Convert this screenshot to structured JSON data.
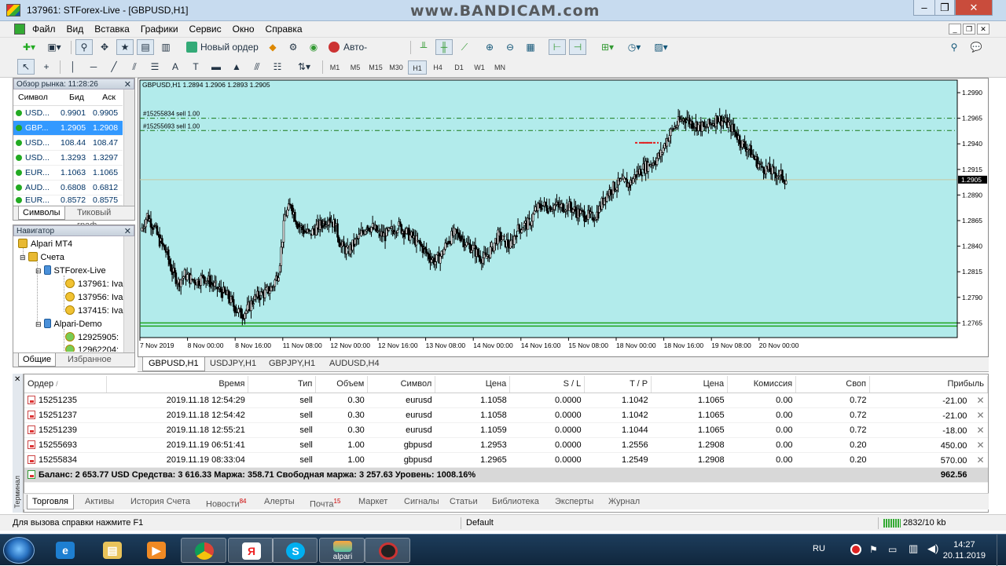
{
  "window": {
    "title": "137961: STForex-Live - [GBPUSD,H1]",
    "watermark": "www.BANDICAM.com"
  },
  "menu": [
    "Файл",
    "Вид",
    "Вставка",
    "Графики",
    "Сервис",
    "Окно",
    "Справка"
  ],
  "toolbar": {
    "new_order": "Новый ордер",
    "autotrading": "Авто-торговля",
    "timeframes": [
      "M1",
      "M5",
      "M15",
      "M30",
      "H1",
      "H4",
      "D1",
      "W1",
      "MN"
    ],
    "active_timeframe": "H1"
  },
  "market_watch": {
    "title": "Обзор рынка: 11:28:26",
    "headers": {
      "symbol": "Символ",
      "bid": "Бид",
      "ask": "Аск"
    },
    "rows": [
      {
        "symbol": "USD...",
        "bid": "0.9901",
        "ask": "0.9905"
      },
      {
        "symbol": "GBP...",
        "bid": "1.2905",
        "ask": "1.2908"
      },
      {
        "symbol": "USD...",
        "bid": "108.44",
        "ask": "108.47"
      },
      {
        "symbol": "USD...",
        "bid": "1.3293",
        "ask": "1.3297"
      },
      {
        "symbol": "EUR...",
        "bid": "1.1063",
        "ask": "1.1065"
      },
      {
        "symbol": "AUD...",
        "bid": "0.6808",
        "ask": "0.6812"
      },
      {
        "symbol": "EUR...",
        "bid": "0.8572",
        "ask": "0.8575"
      }
    ],
    "tabs": [
      "Символы",
      "Тиковый граф"
    ]
  },
  "navigator": {
    "title": "Навигатор",
    "nodes": [
      "Alpari MT4",
      "Счета",
      "STForex-Live",
      "137961: Iva",
      "137956: Iva",
      "137415: Iva",
      "Alpari-Demo",
      "12925905:",
      "12962204:"
    ],
    "tabs": [
      "Общие",
      "Избранное"
    ]
  },
  "chart": {
    "header": "GBPUSD,H1  1.2894 1.2906 1.2893 1.2905",
    "order_lines": [
      "#15255834 sell 1.00",
      "#15255693 sell 1.00"
    ],
    "current_price": "1.2905",
    "background": "#b2ebeb",
    "candle_color": "#000000",
    "tabs": [
      "GBPUSD,H1",
      "USDJPY,H1",
      "GBPJPY,H1",
      "AUDUSD,H4"
    ]
  },
  "chart_data": {
    "type": "candlestick",
    "symbol": "GBPUSD",
    "timeframe": "H1",
    "ylim": [
      1.2753,
      1.3
    ],
    "y_ticks": [
      "1.2990",
      "1.2965",
      "1.2940",
      "1.2915",
      "1.2890",
      "1.2865",
      "1.2840",
      "1.2815",
      "1.2790",
      "1.2765"
    ],
    "x_ticks": [
      "7 Nov 2019",
      "8 Nov 00:00",
      "8 Nov 16:00",
      "11 Nov 08:00",
      "12 Nov 00:00",
      "12 Nov 16:00",
      "13 Nov 08:00",
      "14 Nov 00:00",
      "14 Nov 16:00",
      "15 Nov 08:00",
      "18 Nov 00:00",
      "18 Nov 16:00",
      "19 Nov 08:00",
      "20 Nov 00:00"
    ],
    "close_path": [
      1.2855,
      1.287,
      1.286,
      1.2845,
      1.2835,
      1.2815,
      1.2805,
      1.2812,
      1.2808,
      1.2806,
      1.281,
      1.2805,
      1.28,
      1.2795,
      1.279,
      1.278,
      1.2773,
      1.2778,
      1.2788,
      1.2792,
      1.2795,
      1.28,
      1.2815,
      1.287,
      1.288,
      1.2862,
      1.2855,
      1.2852,
      1.2858,
      1.2862,
      1.2868,
      1.286,
      1.284,
      1.2835,
      1.2842,
      1.285,
      1.286,
      1.2858,
      1.2852,
      1.285,
      1.2855,
      1.286,
      1.2855,
      1.285,
      1.2845,
      1.2838,
      1.283,
      1.2825,
      1.2832,
      1.2845,
      1.2852,
      1.285,
      1.2842,
      1.2838,
      1.283,
      1.2828,
      1.2838,
      1.285,
      1.2845,
      1.284,
      1.2855,
      1.286,
      1.2862,
      1.2875,
      1.288,
      1.2878,
      1.288,
      1.2878,
      1.288,
      1.2876,
      1.2872,
      1.287,
      1.2868,
      1.2873,
      1.2888,
      1.2895,
      1.29,
      1.2903,
      1.29,
      1.291,
      1.2915,
      1.292,
      1.2923,
      1.293,
      1.2945,
      1.2955,
      1.2962,
      1.2965,
      1.296,
      1.2958,
      1.2955,
      1.296,
      1.2965,
      1.2962,
      1.2958,
      1.295,
      1.294,
      1.2935,
      1.2925,
      1.2918,
      1.2915,
      1.2912,
      1.291,
      1.2905
    ],
    "order_levels": [
      1.2965,
      1.2953
    ],
    "current_price": 1.2905,
    "support_level": 1.2765
  },
  "chart_tabs": [
    "GBPUSD,H1",
    "USDJPY,H1",
    "GBPJPY,H1",
    "AUDUSD,H4"
  ],
  "terminal": {
    "side_label": "Терминал",
    "headers": [
      "Ордер",
      "/",
      "Время",
      "Тип",
      "Объем",
      "Символ",
      "Цена",
      "S / L",
      "T / P",
      "Цена",
      "Комиссия",
      "Своп",
      "Прибыль"
    ],
    "orders": [
      {
        "order": "15251235",
        "time": "2019.11.18 12:54:29",
        "type": "sell",
        "volume": "0.30",
        "symbol": "eurusd",
        "price": "1.1058",
        "sl": "0.0000",
        "tp": "1.1042",
        "cur": "1.1065",
        "commission": "0.00",
        "swap": "0.72",
        "profit": "-21.00"
      },
      {
        "order": "15251237",
        "time": "2019.11.18 12:54:42",
        "type": "sell",
        "volume": "0.30",
        "symbol": "eurusd",
        "price": "1.1058",
        "sl": "0.0000",
        "tp": "1.1042",
        "cur": "1.1065",
        "commission": "0.00",
        "swap": "0.72",
        "profit": "-21.00"
      },
      {
        "order": "15251239",
        "time": "2019.11.18 12:55:21",
        "type": "sell",
        "volume": "0.30",
        "symbol": "eurusd",
        "price": "1.1059",
        "sl": "0.0000",
        "tp": "1.1044",
        "cur": "1.1065",
        "commission": "0.00",
        "swap": "0.72",
        "profit": "-18.00"
      },
      {
        "order": "15255693",
        "time": "2019.11.19 06:51:41",
        "type": "sell",
        "volume": "1.00",
        "symbol": "gbpusd",
        "price": "1.2953",
        "sl": "0.0000",
        "tp": "1.2556",
        "cur": "1.2908",
        "commission": "0.00",
        "swap": "0.20",
        "profit": "450.00"
      },
      {
        "order": "15255834",
        "time": "2019.11.19 08:33:04",
        "type": "sell",
        "volume": "1.00",
        "symbol": "gbpusd",
        "price": "1.2965",
        "sl": "0.0000",
        "tp": "1.2549",
        "cur": "1.2908",
        "commission": "0.00",
        "swap": "0.20",
        "profit": "570.00"
      }
    ],
    "balance_line": "Баланс: 2 653.77 USD  Средства: 3 616.33  Маржа: 358.71  Свободная маржа: 3 257.63  Уровень: 1008.16%",
    "total_profit": "962.56",
    "tabs": [
      {
        "label": "Торговля",
        "badge": ""
      },
      {
        "label": "Активы",
        "badge": ""
      },
      {
        "label": "История Счета",
        "badge": ""
      },
      {
        "label": "Новости",
        "badge": "84"
      },
      {
        "label": "Алерты",
        "badge": ""
      },
      {
        "label": "Почта",
        "badge": "15"
      },
      {
        "label": "Маркет",
        "badge": ""
      },
      {
        "label": "Сигналы",
        "badge": ""
      },
      {
        "label": "Статьи",
        "badge": ""
      },
      {
        "label": "Библиотека",
        "badge": ""
      },
      {
        "label": "Эксперты",
        "badge": ""
      },
      {
        "label": "Журнал",
        "badge": ""
      }
    ]
  },
  "status": {
    "help": "Для вызова справки нажмите F1",
    "profile": "Default",
    "traffic": "2832/10 kb"
  },
  "taskbar": {
    "lang": "RU",
    "time": "14:27",
    "date": "20.11.2019",
    "alpari_label": "alpari"
  }
}
